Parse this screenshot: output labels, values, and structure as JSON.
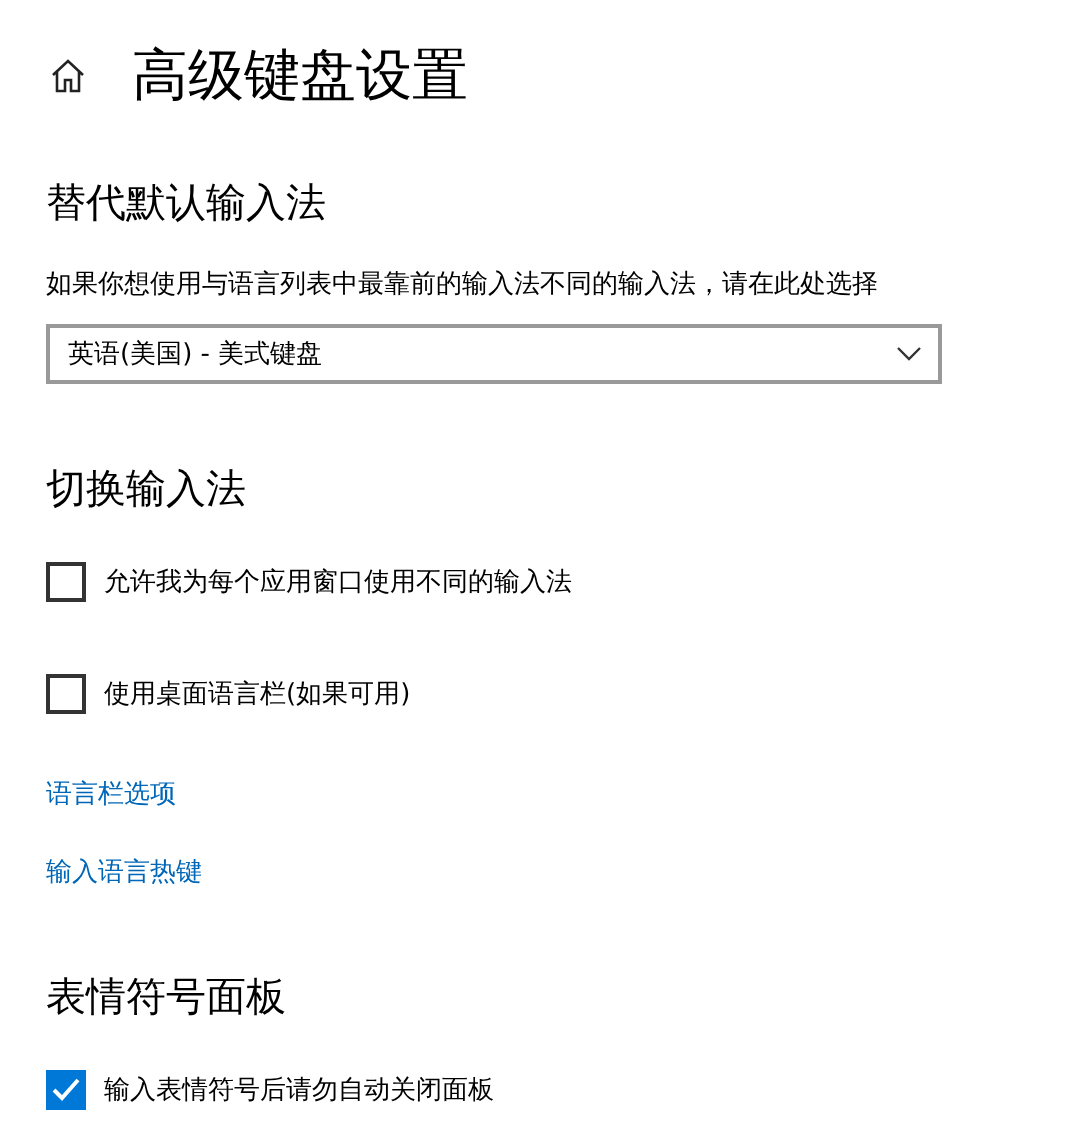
{
  "page": {
    "title": "高级键盘设置"
  },
  "sections": [
    {
      "heading": "替代默认输入法",
      "items": [
        {
          "kind": "description",
          "text": "如果你想使用与语言列表中最靠前的输入法不同的输入法，请在此处选择"
        },
        {
          "kind": "dropdown",
          "value": "英语(美国) - 美式键盘"
        }
      ]
    },
    {
      "heading": "切换输入法",
      "items": [
        {
          "kind": "checkbox",
          "label": "允许我为每个应用窗口使用不同的输入法",
          "checked": false
        },
        {
          "kind": "checkbox",
          "label": "使用桌面语言栏(如果可用)",
          "checked": false
        },
        {
          "kind": "link",
          "text": "语言栏选项"
        },
        {
          "kind": "link",
          "text": "输入语言热键"
        }
      ]
    },
    {
      "heading": "表情符号面板",
      "items": [
        {
          "kind": "checkbox",
          "label": "输入表情符号后请勿自动关闭面板",
          "checked": true
        }
      ]
    }
  ]
}
